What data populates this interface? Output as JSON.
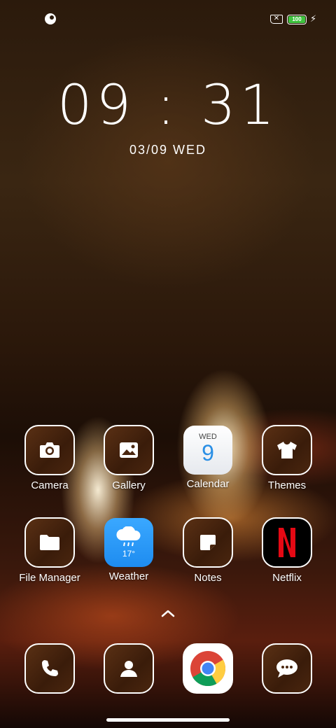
{
  "status_bar": {
    "battery_level": "100",
    "sim_symbol": "✕"
  },
  "clock": {
    "time": "09 : 31",
    "date": "03/09 WED"
  },
  "apps": {
    "camera": "Camera",
    "gallery": "Gallery",
    "calendar": "Calendar",
    "calendar_day": "WED",
    "calendar_date": "9",
    "themes": "Themes",
    "file_manager": "File Manager",
    "weather": "Weather",
    "weather_temp": "17°",
    "notes": "Notes",
    "netflix": "Netflix"
  },
  "dock": [
    "phone-icon",
    "contacts-icon",
    "chrome-icon",
    "messages-icon"
  ],
  "colors": {
    "calendar_number": "#2a8fe5",
    "weather_bg": "#2196f3",
    "netflix_red": "#e50914",
    "battery_green": "#3ec43e"
  }
}
